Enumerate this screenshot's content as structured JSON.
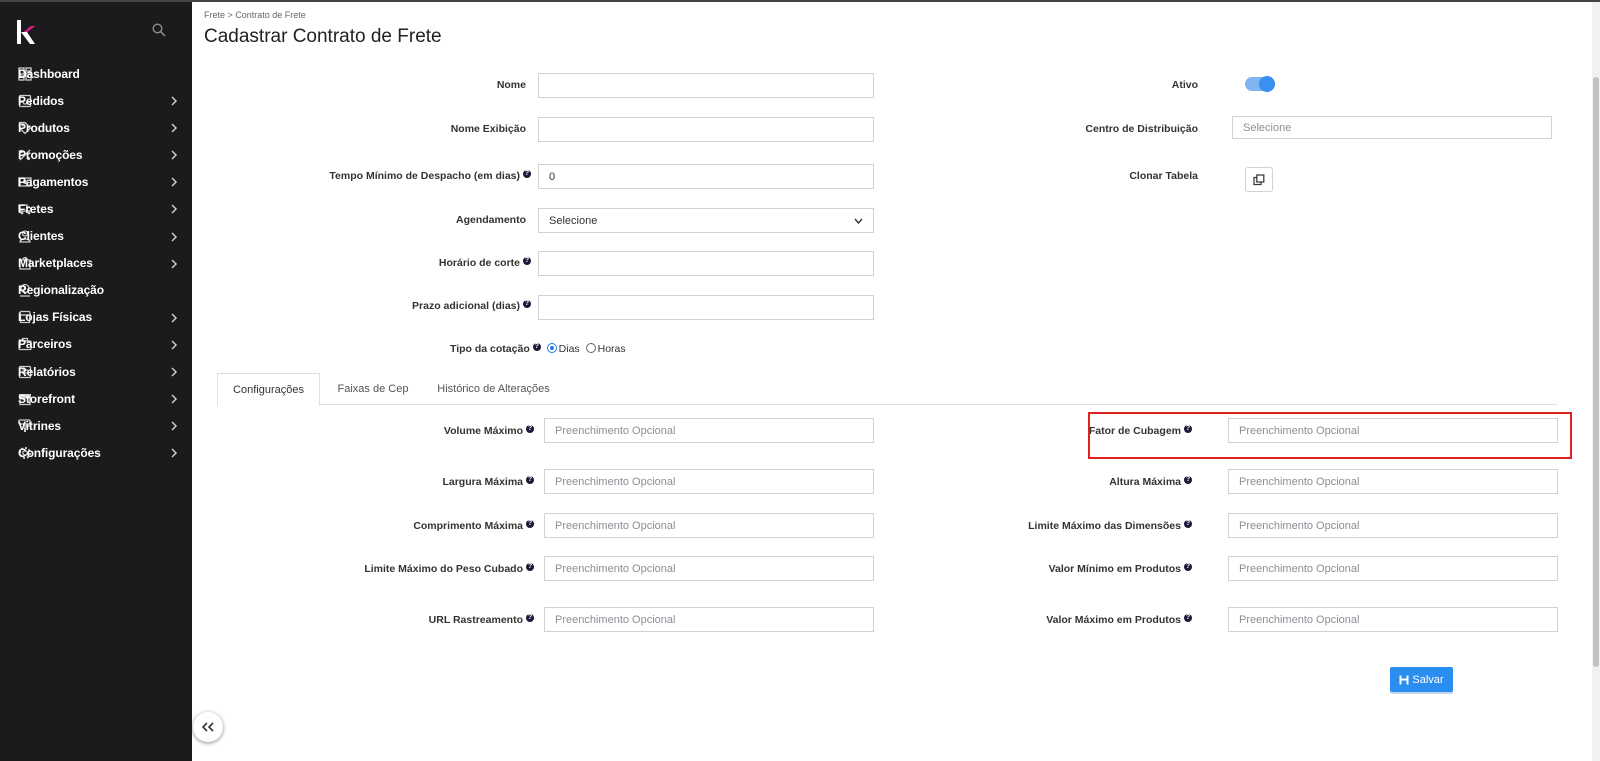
{
  "sidebar": {
    "items": [
      {
        "label": "Dashboard",
        "icon": "dashboard-icon",
        "has_submenu": false
      },
      {
        "label": "Pedidos",
        "icon": "inbox-icon",
        "has_submenu": true
      },
      {
        "label": "Produtos",
        "icon": "tag-icon",
        "has_submenu": true
      },
      {
        "label": "Promoções",
        "icon": "percent-icon",
        "has_submenu": true
      },
      {
        "label": "Pagamentos",
        "icon": "money-icon",
        "has_submenu": true
      },
      {
        "label": "Fretes",
        "icon": "truck-icon",
        "has_submenu": true
      },
      {
        "label": "Clientes",
        "icon": "person-icon",
        "has_submenu": true
      },
      {
        "label": "Marketplaces",
        "icon": "bag-icon",
        "has_submenu": true
      },
      {
        "label": "Regionalização",
        "icon": "location-pin-icon",
        "has_submenu": false
      },
      {
        "label": "Lojas Físicas",
        "icon": "store-icon",
        "has_submenu": true
      },
      {
        "label": "Parceiros",
        "icon": "briefcase-icon",
        "has_submenu": true
      },
      {
        "label": "Relatórios",
        "icon": "report-icon",
        "has_submenu": true
      },
      {
        "label": "Storefront",
        "icon": "storefront-icon",
        "has_submenu": true
      },
      {
        "label": "Vitrines",
        "icon": "paint-roller-icon",
        "has_submenu": true
      },
      {
        "label": "Configurações",
        "icon": "gear-icon",
        "has_submenu": true
      }
    ]
  },
  "breadcrumb": "Frete > Contrato de Frete",
  "page_title": "Cadastrar Contrato de Frete",
  "form": {
    "nome": {
      "label": "Nome",
      "value": ""
    },
    "nome_exibicao": {
      "label": "Nome Exibição",
      "value": ""
    },
    "tempo_minimo": {
      "label": "Tempo Mínimo de Despacho (em dias)",
      "value": "0"
    },
    "agendamento": {
      "label": "Agendamento",
      "value": "Selecione"
    },
    "horario_corte": {
      "label": "Horário de corte",
      "value": ""
    },
    "prazo_adicional": {
      "label": "Prazo adicional (dias)",
      "value": ""
    },
    "tipo_cotacao": {
      "label": "Tipo da cotação",
      "option_dias": "Dias",
      "option_horas": "Horas",
      "selected": "Dias"
    },
    "ativo": {
      "label": "Ativo",
      "checked": true
    },
    "centro_distribuicao": {
      "label": "Centro de Distribuição",
      "placeholder": "Selecione"
    },
    "clonar_tabela": {
      "label": "Clonar Tabela"
    }
  },
  "tabs": [
    "Configurações",
    "Faixas de Cep",
    "Histórico de Alterações"
  ],
  "config": {
    "placeholder": "Preenchimento Opcional",
    "left_fields": [
      "Volume Máximo",
      "Largura Máxima",
      "Comprimento Máxima",
      "Limite Máximo do Peso Cubado",
      "URL Rastreamento"
    ],
    "right_fields": [
      "Fator de Cubagem",
      "Altura Máxima",
      "Limite Máximo das Dimensões",
      "Valor Mínimo em Produtos",
      "Valor Máximo em Produtos"
    ]
  },
  "save_label": "Salvar",
  "colors": {
    "sidebar_bg": "#1b1b1d",
    "accent": "#2a8ef0",
    "highlight": "#e32020"
  }
}
